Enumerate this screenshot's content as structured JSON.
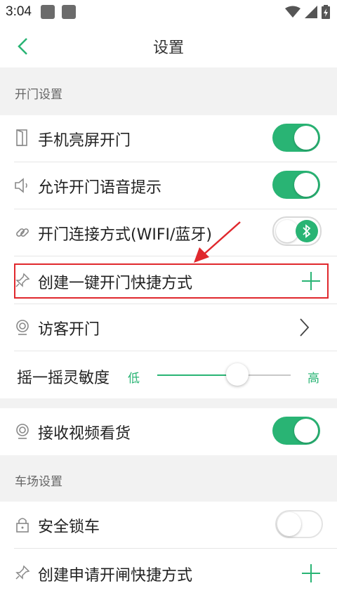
{
  "status_bar": {
    "time": "3:04"
  },
  "header": {
    "title": "设置"
  },
  "sections": {
    "door": "开门设置",
    "parking": "车场设置"
  },
  "rows": {
    "screen_open": "手机亮屏开门",
    "voice_prompt": "允许开门语音提示",
    "connection": "开门连接方式(WIFI/蓝牙)",
    "shortcut": "创建一键开门快捷方式",
    "visitor": "访客开门",
    "shake_label": "摇一摇灵敏度",
    "video": "接收视频看货",
    "lock_car": "安全锁车",
    "gate_shortcut": "创建申请开闸快捷方式"
  },
  "toggles": {
    "screen_open": true,
    "voice_prompt": true,
    "connection": false,
    "video": true,
    "lock_car": false
  },
  "slider": {
    "low": "低",
    "high": "高",
    "value": 0.6
  },
  "colors": {
    "accent": "#29b474",
    "highlight": "#e0282d",
    "section_bg": "#f2f2f2"
  }
}
